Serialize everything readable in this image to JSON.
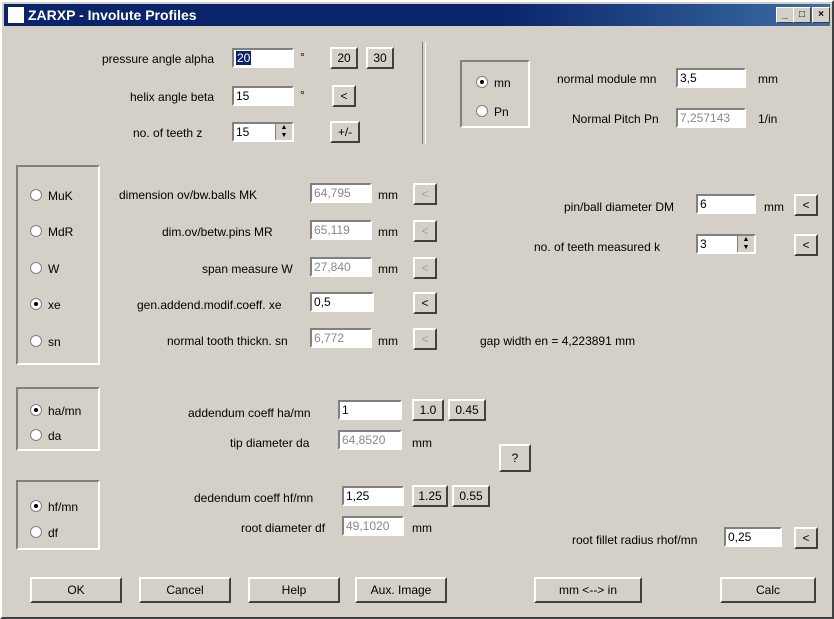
{
  "window": {
    "title": "ZARXP - Involute Profiles"
  },
  "titlebar_buttons": {
    "minimize": "_",
    "maximize": "□",
    "close": "×"
  },
  "top": {
    "pressure_angle_label": "pressure angle alpha",
    "pressure_angle_value": "20",
    "deg1": "°",
    "btn_20": "20",
    "btn_30": "30",
    "helix_label": "helix angle beta",
    "helix_value": "15",
    "deg2": "°",
    "btn_lt": "<",
    "teeth_label": "no. of teeth z",
    "teeth_value": "15",
    "btn_pm": "+/-"
  },
  "module_group": {
    "mn": "mn",
    "pn": "Pn"
  },
  "module": {
    "normal_module_label": "normal module mn",
    "normal_module_value": "3,5",
    "normal_module_unit": "mm",
    "normal_pitch_label": "Normal Pitch Pn",
    "normal_pitch_value": "7,257143",
    "normal_pitch_unit": "1/in"
  },
  "measure_group": {
    "muk": "MuK",
    "mdr": "MdR",
    "w": "W",
    "xe": "xe",
    "sn": "sn"
  },
  "measure": {
    "mk_label": "dimension ov/bw.balls MK",
    "mk_value": "64,795",
    "mk_unit": "mm",
    "mr_label": "dim.ov/betw.pins MR",
    "mr_value": "65,119",
    "mr_unit": "mm",
    "w_label": "span measure W",
    "w_value": "27,840",
    "w_unit": "mm",
    "xe_label": "gen.addend.modif.coeff. xe",
    "xe_value": "0,5",
    "sn_label": "normal tooth thickn. sn",
    "sn_value": "6,772",
    "sn_unit": "mm",
    "lt": "<",
    "gap_text": "gap width en = 4,223891 mm"
  },
  "pin": {
    "dm_label": "pin/ball diameter DM",
    "dm_value": "6",
    "dm_unit": "mm",
    "k_label": "no. of teeth measured k",
    "k_value": "3",
    "lt": "<"
  },
  "addendum_group": {
    "hamn": "ha/mn",
    "da": "da"
  },
  "addendum": {
    "label": "addendum coeff ha/mn",
    "value": "1",
    "btn_10": "1.0",
    "btn_045": "0.45",
    "tip_label": "tip diameter da",
    "tip_value": "64,8520",
    "tip_unit": "mm",
    "question": "?"
  },
  "dedendum_group": {
    "hfmn": "hf/mn",
    "df": "df"
  },
  "dedendum": {
    "label": "dedendum coeff hf/mn",
    "value": "1,25",
    "btn_125": "1.25",
    "btn_055": "0.55",
    "root_label": "root diameter df",
    "root_value": "49,1020",
    "root_unit": "mm"
  },
  "fillet": {
    "label": "root fillet radius rhof/mn",
    "value": "0,25",
    "lt": "<"
  },
  "buttons": {
    "ok": "OK",
    "cancel": "Cancel",
    "help": "Help",
    "aux": "Aux. Image",
    "convert": "mm <--> in",
    "calc": "Calc"
  }
}
